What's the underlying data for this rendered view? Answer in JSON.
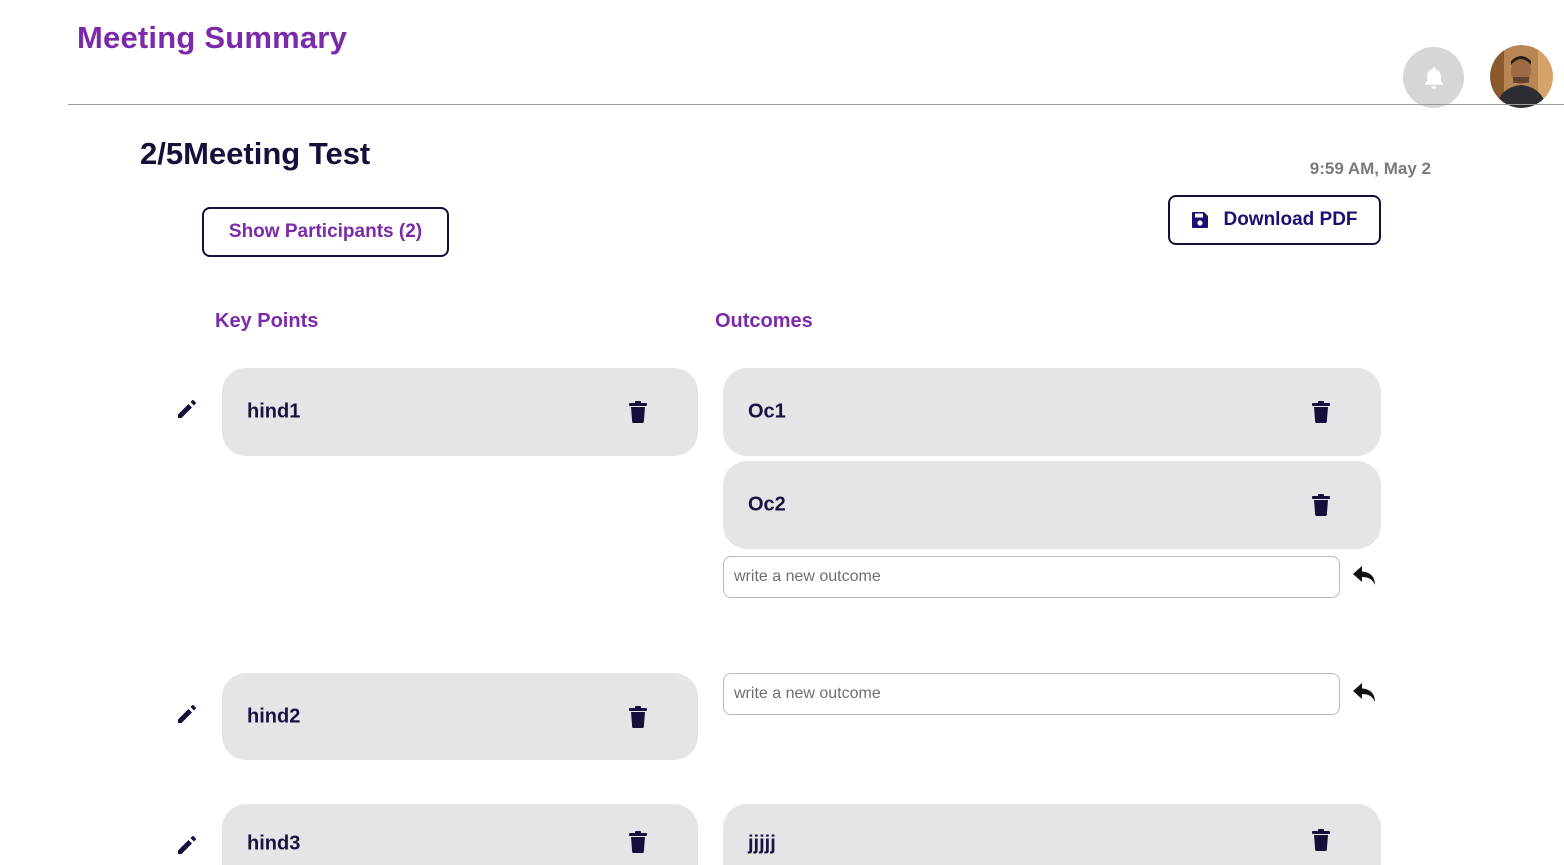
{
  "header": {
    "app_title": "Meeting Summary",
    "notification_icon": "bell-icon",
    "avatar_alt": "user-avatar"
  },
  "meeting": {
    "title": "2/5Meeting Test",
    "timestamp": "9:59 AM, May 2"
  },
  "actions": {
    "participants_label": "Show Participants (2)",
    "download_label": "Download PDF",
    "download_icon": "floppy-disk-icon"
  },
  "columns": {
    "key_points_heading": "Key Points",
    "outcomes_heading": "Outcomes"
  },
  "key_points": [
    {
      "text": "hind1",
      "outcomes": [
        "Oc1",
        "Oc2"
      ],
      "new_outcome_placeholder": "write a new outcome"
    },
    {
      "text": "hind2",
      "outcomes": [],
      "new_outcome_placeholder": "write a new outcome"
    },
    {
      "text": "hind3",
      "outcomes": [
        "jjjjj"
      ]
    }
  ],
  "colors": {
    "accent_purple": "#7b2aa9",
    "dark_navy": "#160f3a",
    "card_bg": "#e6e4e7"
  }
}
